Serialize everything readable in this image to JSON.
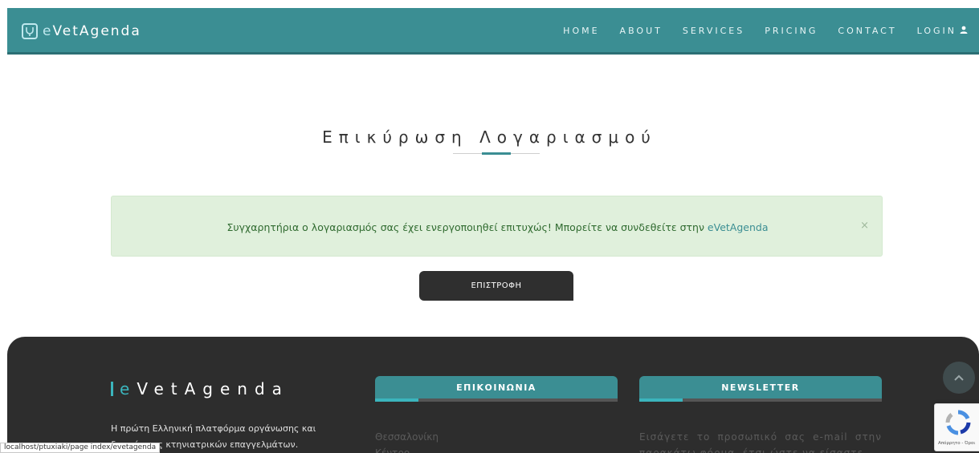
{
  "navbar": {
    "brand_prefix": "e",
    "brand_rest": "VetAgenda",
    "items": [
      {
        "label": "HOME"
      },
      {
        "label": "ABOUT"
      },
      {
        "label": "SERVICES"
      },
      {
        "label": "PRICING"
      },
      {
        "label": "CONTACT"
      },
      {
        "label": "LOGIN"
      }
    ],
    "brand_icon": "stethoscope-icon",
    "login_icon": "user-icon"
  },
  "main": {
    "title": "Επικύρωση Λογαριασμού",
    "alert": {
      "message": "Συγχαρητήρια ο λογαριασμός σας έχει ενεργοποιηθεί επιτυχώς! Μπορείτε να συνδεθείτε στην ",
      "link": "eVetAgenda",
      "close": "×"
    },
    "back_button": "ΕΠΙΣΤΡΟΦΗ"
  },
  "footer": {
    "brand_prefix": "e",
    "brand_rest": "VetAgenda",
    "description": "Η πρώτη Ελληνική πλατφόρμα οργάνωσης και διαχείρισης κτηνιατρικών επαγγελμάτων.",
    "contact": {
      "title": "ΕΠΙΚΟΙΝΩΝΙΑ",
      "lines": [
        "Θεσσαλονίκη",
        "Κέντρο"
      ]
    },
    "newsletter": {
      "title": "NEWSLETTER",
      "text": "Εισάγετε το προσωπικό σας e-mail στην παρακάτω φόρμα, έτσι ώστε να είσαστε"
    }
  },
  "recaptcha": {
    "text": "Απόρρητο - Όροι"
  },
  "statusbar": {
    "url": "localhost/ptuxiaki/page index/evetagenda"
  },
  "colors": {
    "primary": "#3b8e93",
    "dark": "#2d2d2d",
    "alert_bg": "#e0f0dc",
    "alert_text": "#2f6a2f"
  }
}
